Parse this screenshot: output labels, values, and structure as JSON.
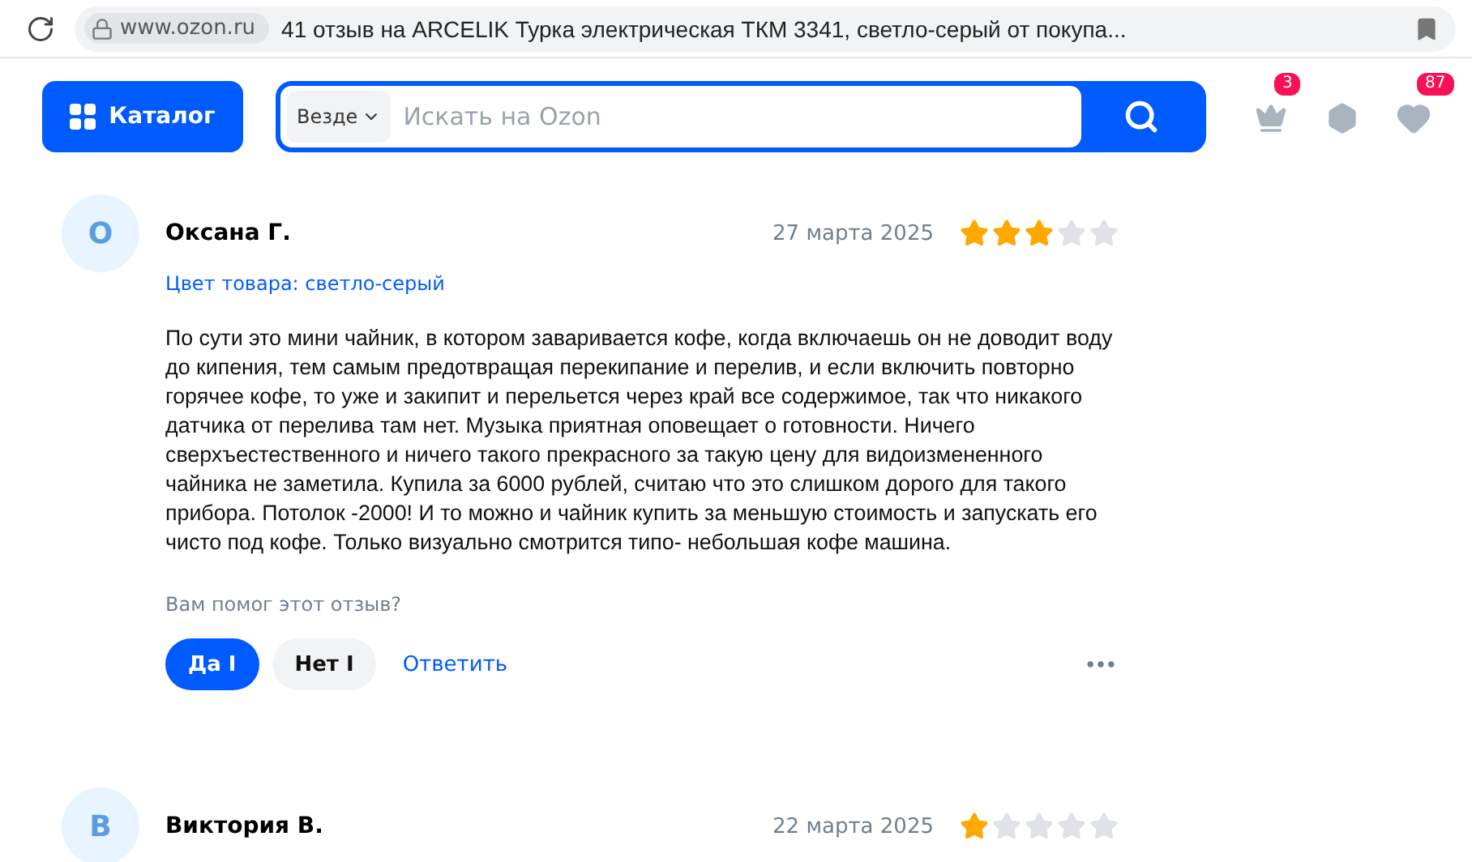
{
  "browser": {
    "domain": "www.ozon.ru",
    "title": "41 отзыв на ARCELIK Турка электрическая ТКМ 3341, светло-серый от покупа..."
  },
  "header": {
    "catalog": "Каталог",
    "scope": "Везде",
    "placeholder": "Искать на Ozon",
    "badges": [
      {
        "kind": "orders",
        "count": "3"
      },
      {
        "kind": "box"
      },
      {
        "kind": "favorites",
        "count": "87"
      }
    ]
  },
  "reviews": [
    {
      "initial": "О",
      "author": "Оксана Г.",
      "date": "27 марта 2025",
      "stars": 3,
      "variant": "Цвет товара: светло-серый",
      "text": "По сути это мини чайник, в котором заваривается кофе, когда включаешь он не доводит воду до кипения, тем самым предотвращая перекипание и перелив, и если включить повторно горячее кофе, то уже и закипит и перельется через край все содержимое, так что никакого датчика от перелива там нет. Музыка приятная оповещает о готовности. Ничего сверхъестественного и ничего такого прекрасного за такую цену для видоизмененного чайника не заметила. Купила за 6000 рублей, считаю что это слишком дорого для такого прибора. Потолок -2000! И то можно и чайник купить за меньшую стоимость и запускать его чисто под кофе. Только визуально смотрится типо- небольшая кофе машина.",
      "helpful": "Вам помог этот отзыв?",
      "yes": {
        "label": "Да I",
        "selected": true
      },
      "no": {
        "label": "Нет I",
        "selected": false
      },
      "reply": "Ответить"
    },
    {
      "initial": "В",
      "author": "Виктория В.",
      "date": "22 марта 2025",
      "stars": 1
    }
  ]
}
